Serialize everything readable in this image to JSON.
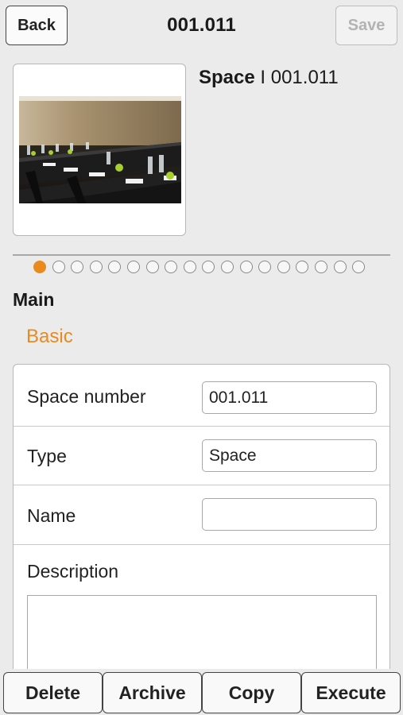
{
  "header": {
    "back_label": "Back",
    "title": "001.011",
    "save_label": "Save"
  },
  "record": {
    "kind": "Space",
    "separator": "I",
    "number": "001.011",
    "photo_icon": "conference-room-photo"
  },
  "pager": {
    "total": 18,
    "active_index": 0,
    "active_color": "#e98a1e"
  },
  "section": {
    "title": "Main",
    "tab": "Basic"
  },
  "form": {
    "space_number": {
      "label": "Space number",
      "value": "001.011"
    },
    "type": {
      "label": "Type",
      "value": "Space"
    },
    "name": {
      "label": "Name",
      "value": ""
    },
    "description": {
      "label": "Description",
      "value": ""
    }
  },
  "toolbar": {
    "delete_label": "Delete",
    "archive_label": "Archive",
    "copy_label": "Copy",
    "execute_label": "Execute"
  },
  "colors": {
    "accent": "#e98a1e",
    "background": "#ebebeb"
  }
}
